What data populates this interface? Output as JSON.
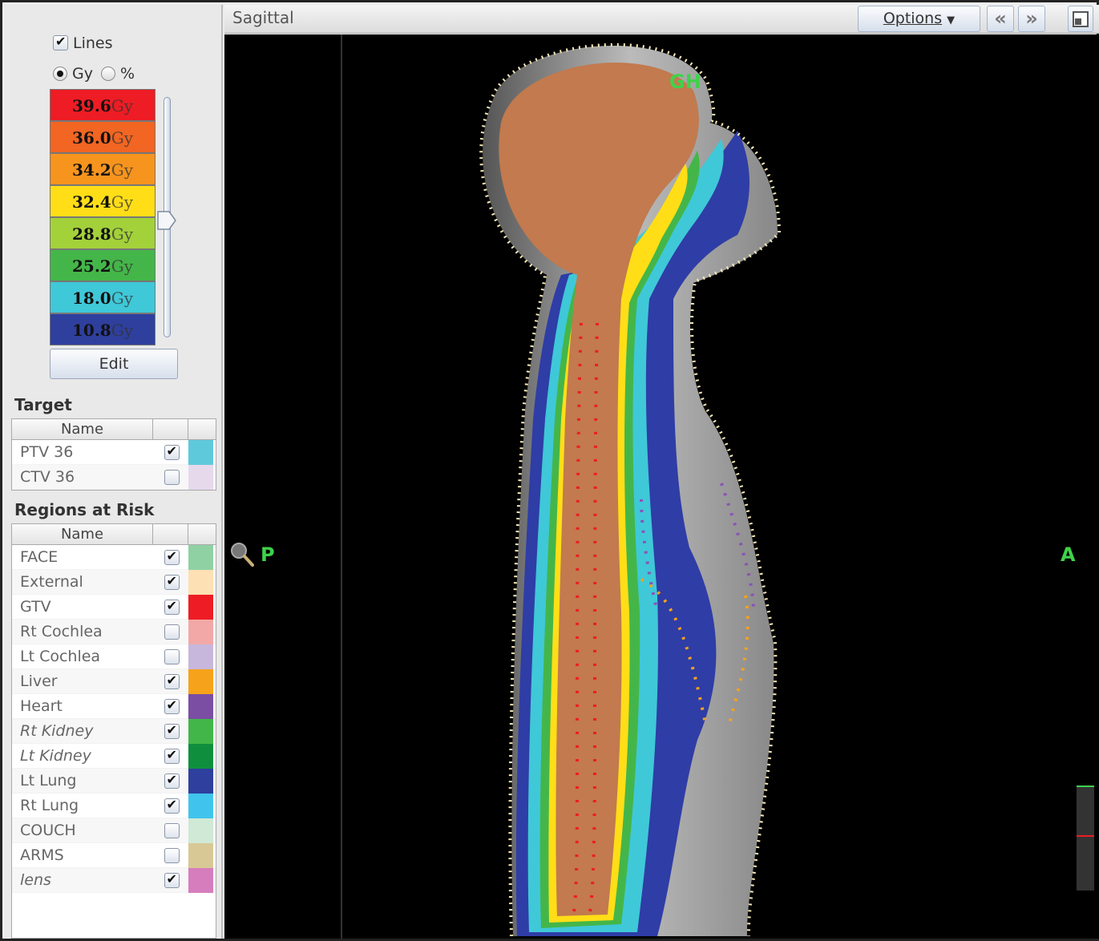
{
  "left_panel": {
    "lines_label": "Lines",
    "lines_checked": true,
    "unit_options": [
      "Gy",
      "%"
    ],
    "unit_selected": "Gy",
    "dose_levels": [
      {
        "value": "39.6",
        "unit": "Gy",
        "color": "#ee1c24"
      },
      {
        "value": "36.0",
        "unit": "Gy",
        "color": "#f26522"
      },
      {
        "value": "34.2",
        "unit": "Gy",
        "color": "#f7941d"
      },
      {
        "value": "32.4",
        "unit": "Gy",
        "color": "#ffde17"
      },
      {
        "value": "28.8",
        "unit": "Gy",
        "color": "#a3d13a"
      },
      {
        "value": "25.2",
        "unit": "Gy",
        "color": "#44b649"
      },
      {
        "value": "18.0",
        "unit": "Gy",
        "color": "#3fc8d8"
      },
      {
        "value": "10.8",
        "unit": "Gy",
        "color": "#2e3f9e"
      }
    ],
    "edit_label": "Edit",
    "target_title": "Target",
    "target_header": "Name",
    "targets": [
      {
        "name": "PTV 36",
        "checked": true,
        "color": "#5fc9dc",
        "italic": false
      },
      {
        "name": "CTV 36",
        "checked": false,
        "color": "#e6d9ec",
        "italic": false
      }
    ],
    "risk_title": "Regions at Risk",
    "risk_header": "Name",
    "regions": [
      {
        "name": "FACE",
        "checked": true,
        "color": "#8fd1a3",
        "italic": false
      },
      {
        "name": "External",
        "checked": true,
        "color": "#fde0b3",
        "italic": false
      },
      {
        "name": "GTV",
        "checked": true,
        "color": "#ee1c24",
        "italic": false
      },
      {
        "name": "Rt Cochlea",
        "checked": false,
        "color": "#f2a8a6",
        "italic": false
      },
      {
        "name": "Lt Cochlea",
        "checked": false,
        "color": "#c7b7dc",
        "italic": false
      },
      {
        "name": "Liver",
        "checked": true,
        "color": "#f7a21b",
        "italic": false
      },
      {
        "name": "Heart",
        "checked": true,
        "color": "#7b4ea3",
        "italic": false
      },
      {
        "name": "Rt Kidney",
        "checked": true,
        "color": "#43b649",
        "italic": true
      },
      {
        "name": "Lt Kidney",
        "checked": true,
        "color": "#0f8f3e",
        "italic": true
      },
      {
        "name": "Lt Lung",
        "checked": true,
        "color": "#2e3f9e",
        "italic": false
      },
      {
        "name": "Rt Lung",
        "checked": true,
        "color": "#40c4ee",
        "italic": false
      },
      {
        "name": "COUCH",
        "checked": false,
        "color": "#cfe9d6",
        "italic": false
      },
      {
        "name": "ARMS",
        "checked": false,
        "color": "#d8c895",
        "italic": false
      },
      {
        "name": "lens",
        "checked": true,
        "color": "#d67dbd",
        "italic": true
      }
    ]
  },
  "viewer": {
    "title": "Sagittal",
    "options_label": "Options",
    "prev_icon": "double-chevron-left-icon",
    "next_icon": "double-chevron-right-icon",
    "layout_icon": "window-layout-icon",
    "zoom_icon": "magnifier-icon",
    "left_orientation": "P",
    "right_orientation": "A",
    "head_label": "GH"
  }
}
